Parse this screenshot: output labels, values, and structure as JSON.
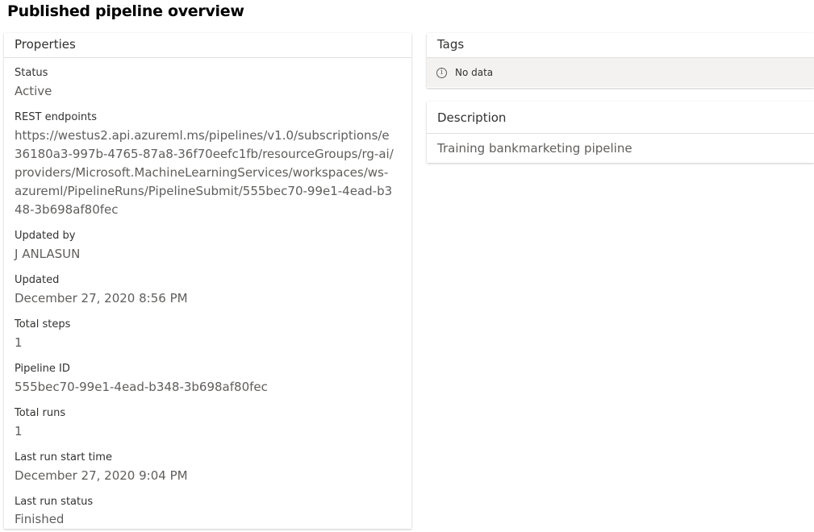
{
  "page_title": "Published pipeline overview",
  "properties": {
    "header": "Properties",
    "status_label": "Status",
    "status_value": "Active",
    "rest_label": "REST endpoints",
    "rest_value": "https://westus2.api.azureml.ms/pipelines/v1.0/subscriptions/e36180a3-997b-4765-87a8-36f70eefc1fb/resourceGroups/rg-ai/providers/Microsoft.MachineLearningServices/workspaces/ws-azureml/PipelineRuns/PipelineSubmit/555bec70-99e1-4ead-b348-3b698af80fec",
    "updated_by_label": "Updated by",
    "updated_by_value": "J ANLASUN",
    "updated_label": "Updated",
    "updated_value": "December 27, 2020 8:56 PM",
    "total_steps_label": "Total steps",
    "total_steps_value": "1",
    "pipeline_id_label": "Pipeline ID",
    "pipeline_id_value": "555bec70-99e1-4ead-b348-3b698af80fec",
    "total_runs_label": "Total runs",
    "total_runs_value": "1",
    "last_run_start_label": "Last run start time",
    "last_run_start_value": "December 27, 2020 9:04 PM",
    "last_run_status_label": "Last run status",
    "last_run_status_value": "Finished"
  },
  "tags": {
    "header": "Tags",
    "empty_text": "No data",
    "icon": "info-icon"
  },
  "description": {
    "header": "Description",
    "text": "Training bankmarketing pipeline"
  }
}
